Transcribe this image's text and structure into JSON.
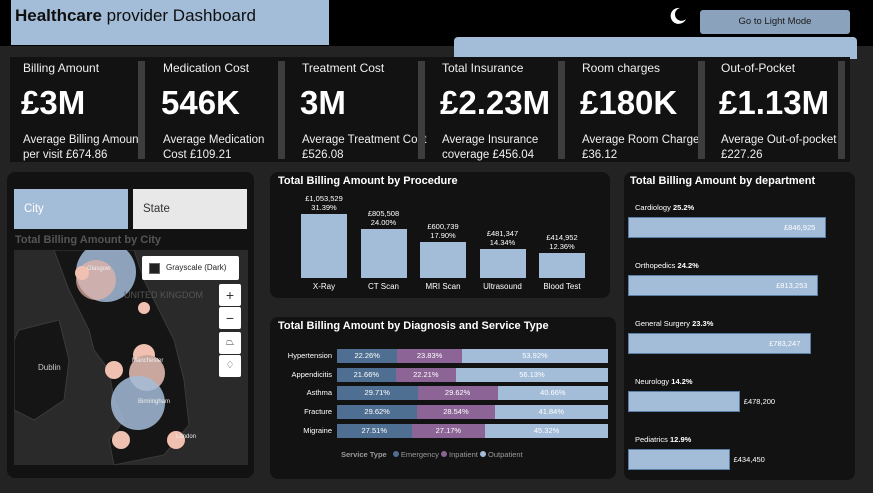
{
  "header": {
    "title_bold": "Healthcare",
    "title_rest": " provider Dashboard",
    "mode_button": "Go to Light Mode"
  },
  "kpis": [
    {
      "label": "Billing Amount",
      "value": "£3M",
      "sub": "Average Billing Amount per visit £674.86"
    },
    {
      "label": "Medication Cost",
      "value": "546K",
      "sub": "Average Medication Cost £109.21"
    },
    {
      "label": "Treatment Cost",
      "value": "3M",
      "sub": "Average Treatment Cost £526.08"
    },
    {
      "label": "Total Insurance",
      "value": "£2.23M",
      "sub": "Average Insurance coverage £456.04"
    },
    {
      "label": "Room charges",
      "value": "£180K",
      "sub": "Average Room Charge £36.12"
    },
    {
      "label": "Out-of-Pocket",
      "value": "£1.13M",
      "sub": "Average Out-of-pocket £227.26"
    }
  ],
  "slicers": {
    "city": "City",
    "state": "State"
  },
  "map": {
    "title": "Total Billing Amount by City",
    "style_label": "Grayscale (Dark)",
    "place_labels": [
      "UNITED KINGDOM",
      "Dublin",
      "Glasgow",
      "Manchester",
      "Birmingham",
      "London"
    ]
  },
  "colors": {
    "emergency": "#4f6f92",
    "inpatient": "#8c6496",
    "outpatient": "#a3bcd8",
    "bar": "#a3bcd8"
  },
  "chart_data": [
    {
      "type": "bar",
      "title": "Total Billing Amount by Procedure",
      "categories": [
        "X-Ray",
        "CT Scan",
        "MRI Scan",
        "Ultrasound",
        "Blood Test"
      ],
      "values": [
        1053529,
        805508,
        600739,
        481347,
        414952
      ],
      "value_labels": [
        "£1,053,529",
        "£805,508",
        "£600,739",
        "£481,347",
        "£414,952"
      ],
      "percent_labels": [
        "31.39%",
        "24.00%",
        "17.90%",
        "14.34%",
        "12.36%"
      ]
    },
    {
      "type": "bar",
      "orientation": "horizontal-stacked-100",
      "title": "Total Billing Amount by Diagnosis and Service Type",
      "categories": [
        "Hypertension",
        "Appendicitis",
        "Asthma",
        "Fracture",
        "Migraine"
      ],
      "legend_title": "Service Type",
      "series": [
        {
          "name": "Emergency",
          "values": [
            22.26,
            21.66,
            29.71,
            29.62,
            27.51
          ]
        },
        {
          "name": "Inpatient",
          "values": [
            23.83,
            22.21,
            29.62,
            28.54,
            27.17
          ]
        },
        {
          "name": "Outpatient",
          "values": [
            53.92,
            56.13,
            40.66,
            41.84,
            45.32
          ]
        }
      ],
      "value_labels": [
        [
          "22.26%",
          "23.83%",
          "53.92%"
        ],
        [
          "21.66%",
          "22.21%",
          "56.13%"
        ],
        [
          "29.71%",
          "29.62%",
          "40.66%"
        ],
        [
          "29.62%",
          "28.54%",
          "41.84%"
        ],
        [
          "27.51%",
          "27.17%",
          "45.32%"
        ]
      ]
    },
    {
      "type": "bar",
      "orientation": "horizontal",
      "title": "Total Billing Amount by department",
      "categories": [
        "Cardiology",
        "Orthopedics",
        "General Surgery",
        "Neurology",
        "Pediatrics"
      ],
      "percent_labels": [
        "25.2%",
        "24.2%",
        "23.3%",
        "14.2%",
        "12.9%"
      ],
      "values": [
        846925,
        813253,
        783247,
        478200,
        434450
      ],
      "value_labels": [
        "£846,925",
        "£813,253",
        "£783,247",
        "£478,200",
        "£434,450"
      ]
    }
  ]
}
